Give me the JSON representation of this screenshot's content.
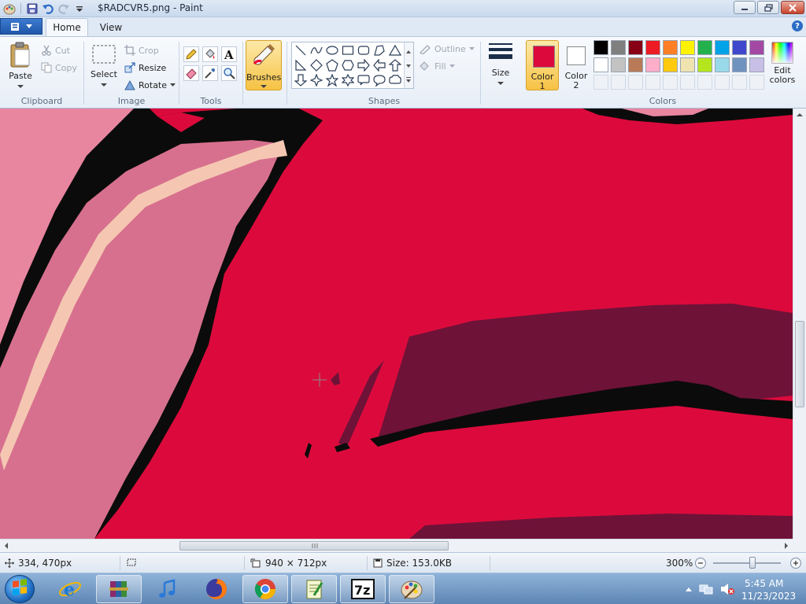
{
  "window": {
    "title": "$RADCVR5.png - Paint"
  },
  "tabs": {
    "home": "Home",
    "view": "View"
  },
  "ribbon": {
    "clipboard": {
      "label": "Clipboard",
      "paste": "Paste",
      "cut": "Cut",
      "copy": "Copy"
    },
    "image": {
      "label": "Image",
      "select": "Select",
      "crop": "Crop",
      "resize": "Resize",
      "rotate": "Rotate"
    },
    "tools": {
      "label": "Tools"
    },
    "brushes": "Brushes",
    "shapes": {
      "label": "Shapes",
      "outline": "Outline",
      "fill": "Fill"
    },
    "size": "Size",
    "color1": {
      "line1": "Color",
      "line2": "1",
      "value": "#dc0a3c"
    },
    "color2": {
      "line1": "Color",
      "line2": "2",
      "value": "#ffffff"
    },
    "colors": {
      "label": "Colors",
      "edit_line1": "Edit",
      "edit_line2": "colors",
      "row1": [
        "#000000",
        "#7f7f7f",
        "#880015",
        "#ed1c24",
        "#ff7f27",
        "#fff200",
        "#22b14c",
        "#00a2e8",
        "#3f48cc",
        "#a349a4"
      ],
      "row2": [
        "#ffffff",
        "#c3c3c3",
        "#b97a57",
        "#ffaec9",
        "#ffc90e",
        "#efe4b0",
        "#b5e61d",
        "#99d9ea",
        "#7092be",
        "#c8bfe7"
      ]
    }
  },
  "status": {
    "cursor_pos": "334, 470px",
    "image_size": "940 × 712px",
    "file_size": "Size: 153.0KB",
    "zoom": "300%",
    "zoom_level_fraction": 0.58
  },
  "taskbar": {
    "time": "5:45 AM",
    "date": "11/23/2023"
  }
}
